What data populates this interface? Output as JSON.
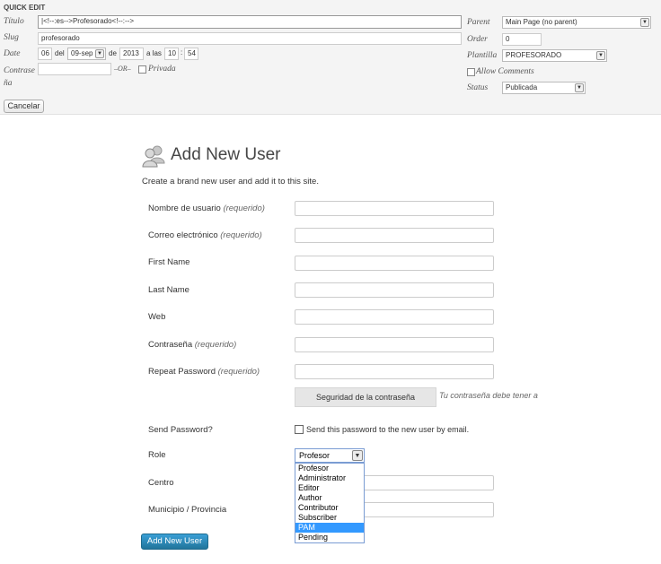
{
  "quick_edit": {
    "heading": "QUICK EDIT",
    "title_label": "Título",
    "title_value": "|<!--:es-->Profesorado<!--:-->",
    "slug_label": "Slug",
    "slug_value": "profesorado",
    "date_label": "Date",
    "date_day": "06",
    "date_del": "del",
    "date_month": "09-sep",
    "date_de": "de",
    "date_year": "2013",
    "date_a_las": "a las",
    "date_hour": "10",
    "date_colon": ":",
    "date_minute": "54",
    "password_label": "Contraseña",
    "or_text": "–OR–",
    "private_label": "Privada",
    "parent_label": "Parent",
    "parent_value": "Main Page (no parent)",
    "order_label": "Order",
    "order_value": "0",
    "template_label": "Plantilla",
    "template_value": "PROFESORADO",
    "allow_comments_label": "Allow Comments",
    "status_label": "Status",
    "status_value": "Publicada",
    "cancel_button": "Cancelar"
  },
  "add_user": {
    "title": "Add New User",
    "description": "Create a brand new user and add it to this site.",
    "fields": {
      "username": {
        "label": "Nombre de usuario",
        "req": "(requerido)"
      },
      "email": {
        "label": "Correo electrónico",
        "req": "(requerido)"
      },
      "first_name": {
        "label": "First Name"
      },
      "last_name": {
        "label": "Last Name"
      },
      "web": {
        "label": "Web"
      },
      "password": {
        "label": "Contraseña",
        "req": "(requerido)"
      },
      "repeat_password": {
        "label": "Repeat Password",
        "req": "(requerido)"
      }
    },
    "strength_button": "Seguridad de la contraseña",
    "strength_hint": "Tu contraseña debe tener a",
    "send_password_label": "Send Password?",
    "send_password_text": "Send this password to the new user by email.",
    "role_label": "Role",
    "role_value": "Profesor",
    "role_options": [
      "Profesor",
      "Administrator",
      "Editor",
      "Author",
      "Contributor",
      "Subscriber",
      "PAM",
      "Pending"
    ],
    "highlighted_option": "PAM",
    "centro_label": "Centro",
    "municipio_label": "Municipio / Provincia",
    "submit_button": "Add New User"
  },
  "colors": {
    "highlight": "#3399ff",
    "primary_button": "#2e8bc0"
  }
}
